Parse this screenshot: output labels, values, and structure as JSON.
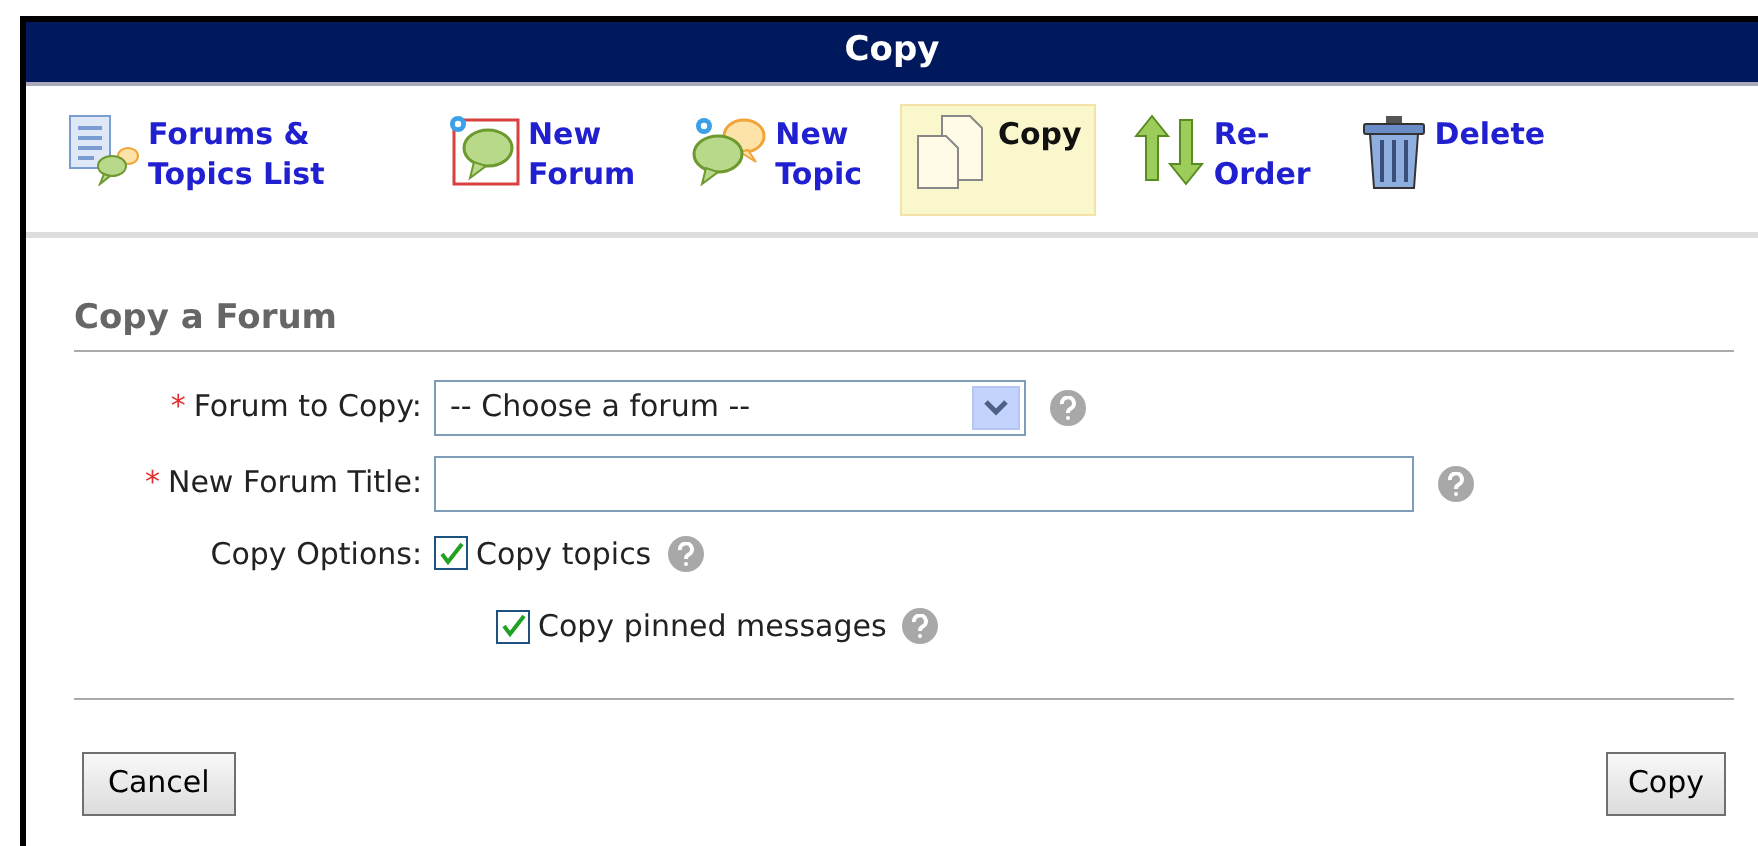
{
  "window": {
    "title": "Copy"
  },
  "toolbar": [
    {
      "kind": "list",
      "label": "Forums & Topics List",
      "selected": false
    },
    {
      "kind": "new-forum",
      "label": "New Forum",
      "selected": false
    },
    {
      "kind": "new-topic",
      "label": "New Topic",
      "selected": false
    },
    {
      "kind": "copy",
      "label": "Copy",
      "selected": true
    },
    {
      "kind": "reorder",
      "label": "Re-Order",
      "selected": false
    },
    {
      "kind": "delete",
      "label": "Delete",
      "selected": false
    }
  ],
  "form": {
    "heading": "Copy a Forum",
    "forum_to_copy": {
      "label": "Forum to Copy:",
      "required_mark": "*",
      "value": "-- Choose a forum --"
    },
    "new_forum_title": {
      "label": "New Forum Title:",
      "required_mark": "*"
    },
    "copy_options": {
      "label": "Copy Options:",
      "options": [
        {
          "label": "Copy topics",
          "checked": true
        },
        {
          "label": "Copy pinned messages",
          "checked": true
        }
      ]
    }
  },
  "buttons": {
    "cancel": "Cancel",
    "submit": "Copy"
  }
}
